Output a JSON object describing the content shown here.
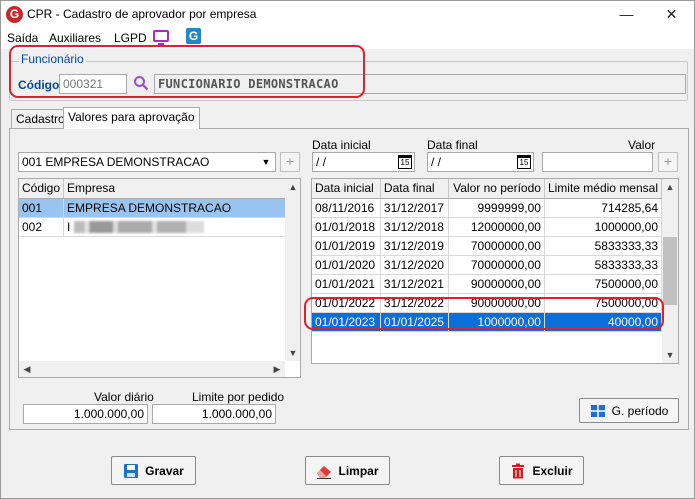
{
  "window": {
    "title": "CPR - Cadastro de aprovador por empresa",
    "logo_letter": "G",
    "minimize": "—",
    "close": "✕"
  },
  "menu": {
    "items": [
      "Saída",
      "Auxiliares",
      "LGPD"
    ],
    "g_icon_letter": "G"
  },
  "funcionario": {
    "legend": "Funcionário",
    "codigo_label": "Código",
    "codigo_value": "000321",
    "nome_value": "FUNCIONARIO DEMONSTRACAO"
  },
  "tabs": [
    {
      "label": "Cadastro",
      "active": false
    },
    {
      "label": "Valores para aprovação",
      "active": true
    }
  ],
  "empresa_combo": {
    "value": "001 EMPRESA DEMONSTRACAO",
    "add_label": "+"
  },
  "empresa_grid": {
    "columns": [
      "Código",
      "Empresa"
    ],
    "rows": [
      {
        "codigo": "001",
        "empresa": "EMPRESA DEMONSTRACAO"
      },
      {
        "codigo": "002",
        "empresa": "I"
      }
    ]
  },
  "periodo_filter": {
    "data_inicial_label": "Data inicial",
    "data_inicial_value": " /  /",
    "data_final_label": "Data final",
    "data_final_value": " /  /",
    "valor_label": "Valor",
    "calendar_day": "15",
    "add_label": "+"
  },
  "periodo_grid": {
    "columns": [
      "Data inicial",
      "Data final",
      "Valor no período",
      "Limite médio mensal"
    ],
    "rows": [
      {
        "inicio": "08/11/2016",
        "fim": "31/12/2017",
        "valor": "9999999,00",
        "limite": "714285,64"
      },
      {
        "inicio": "01/01/2018",
        "fim": "31/12/2018",
        "valor": "12000000,00",
        "limite": "1000000,00"
      },
      {
        "inicio": "01/01/2019",
        "fim": "31/12/2019",
        "valor": "70000000,00",
        "limite": "5833333,33"
      },
      {
        "inicio": "01/01/2020",
        "fim": "31/12/2020",
        "valor": "70000000,00",
        "limite": "5833333,33"
      },
      {
        "inicio": "01/01/2021",
        "fim": "31/12/2021",
        "valor": "90000000,00",
        "limite": "7500000,00"
      },
      {
        "inicio": "01/01/2022",
        "fim": "31/12/2022",
        "valor": "90000000,00",
        "limite": "7500000,00"
      },
      {
        "inicio": "01/01/2023",
        "fim": "01/01/2025",
        "valor": "1000000,00",
        "limite": "40000,00"
      }
    ]
  },
  "limites": {
    "valor_diario_label": "Valor diário",
    "valor_diario_value": "1.000.000,00",
    "limite_pedido_label": "Limite por pedido",
    "limite_pedido_value": "1.000.000,00"
  },
  "buttons": {
    "g_periodo": "G. período",
    "gravar": "Gravar",
    "limpar": "Limpar",
    "excluir": "Excluir"
  },
  "colors": {
    "highlight_red": "#e0202a",
    "selection_blue": "#0a6fd8",
    "selection_light": "#99c4f0",
    "legend_blue": "#0047ab"
  }
}
